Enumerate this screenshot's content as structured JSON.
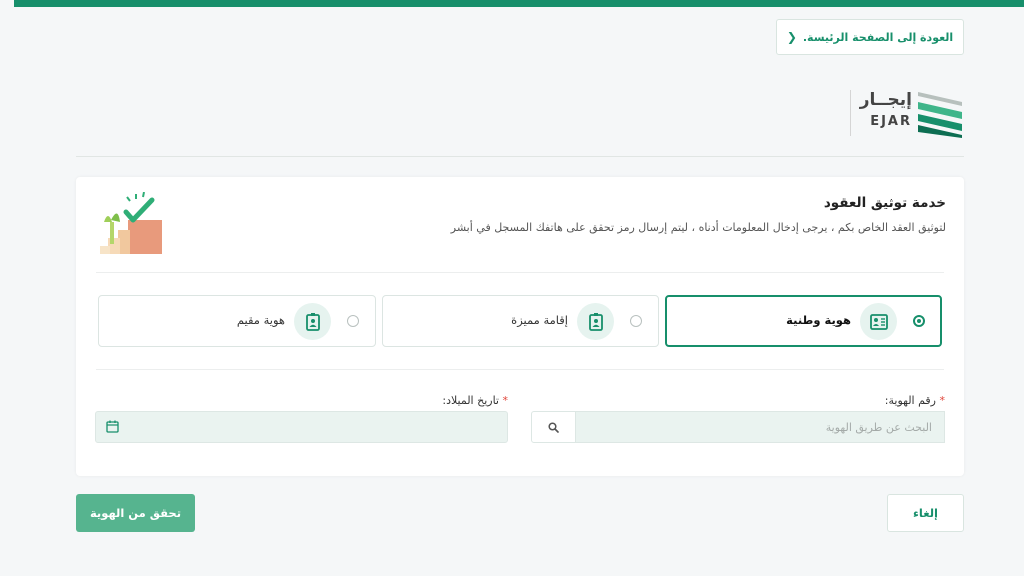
{
  "app": {
    "accent": "#178f6b",
    "accent_light": "#56b48f"
  },
  "nav": {
    "back_label": "العودة إلى الصفحة الرئيسة.",
    "back_icon": "chevron-left-icon"
  },
  "logo": {
    "arabic": "إيجــار",
    "english": "EJAR"
  },
  "service": {
    "title": "خدمة توثيق العقود",
    "subtitle": "لتوثيق العقد الخاص بكم ، يرجى إدخال المعلومات أدناه ، ليتم إرسال رمز تحقق على هاتفك المسجل في أبشر"
  },
  "id_types": [
    {
      "label": "هوية وطنية",
      "icon": "id-card-icon",
      "selected": true
    },
    {
      "label": "إقامة مميزة",
      "icon": "badge-icon",
      "selected": false
    },
    {
      "label": "هوية مقيم",
      "icon": "badge-icon",
      "selected": false
    }
  ],
  "form": {
    "id_label": "رقم الهوية:",
    "id_placeholder": "البحث عن طريق الهوية",
    "dob_label": "تاريخ الميلاد:",
    "required_mark": "*"
  },
  "actions": {
    "verify": "تحقق من الهوية",
    "cancel": "إلغاء"
  }
}
